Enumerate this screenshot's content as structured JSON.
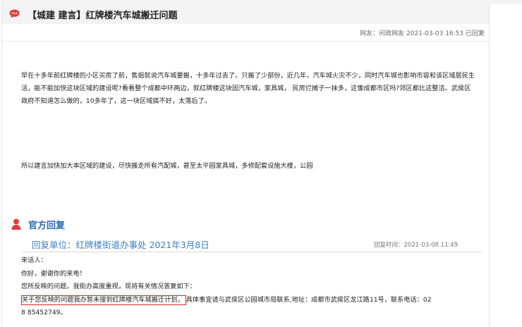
{
  "colors": {
    "accent_red": "#e43c3c",
    "accent_blue": "#2a6ab3",
    "highlight_box": "#e02020"
  },
  "icons": {
    "title": "speech-bubble-icon",
    "reply": "person-icon"
  },
  "complaint": {
    "title": "【城建 建言】红牌楼汽车城搬迁问题",
    "meta": "网友：问政网友  2021-03-03 16:53 已回复",
    "paragraph1": "早在十多年前红牌楼的小区买房了前，售姐就说汽车城要搬，十多年过去了。只搬了少部份，近几年，汽车城火灾不少，同时汽车城也影响市容和该区域居民生活，能不能加快这块区域的建设呢?看看整个成都中环两边，就红牌楼这块因汽车城，家具城， 民房烂摊子一抹多，这像成都市区吗?郊区都比这整洁。武侯区政府不知道怎么做的，10多年了，这一块区域搞不好，太落后了。",
    "paragraph2": "所以建言加快加大本区域的建设，尽快搬走所有汽配城，甚至太平园家具城，多修配套设施大楼，公园"
  },
  "reply": {
    "section_title": "官方回复",
    "unit": "回复单位：红牌楼街道办事处 2021年3月8日",
    "time": "回复时间：2021-03-08 11:49",
    "greeting": "来话人：",
    "thanks": "你好，谢谢你的来电！",
    "intro": "您所反映的问题，我街办高度重视，现将有关情况答复如下：",
    "highlighted": "关于您反映的问题我办暂未接到红牌楼汽车城搬迁计划，",
    "rest": "具体事宜请与武侯区公园城市局联系,地址：成都市武侯区龙江路11号，联系电话：02",
    "phone_tail": "8 85452749。"
  }
}
